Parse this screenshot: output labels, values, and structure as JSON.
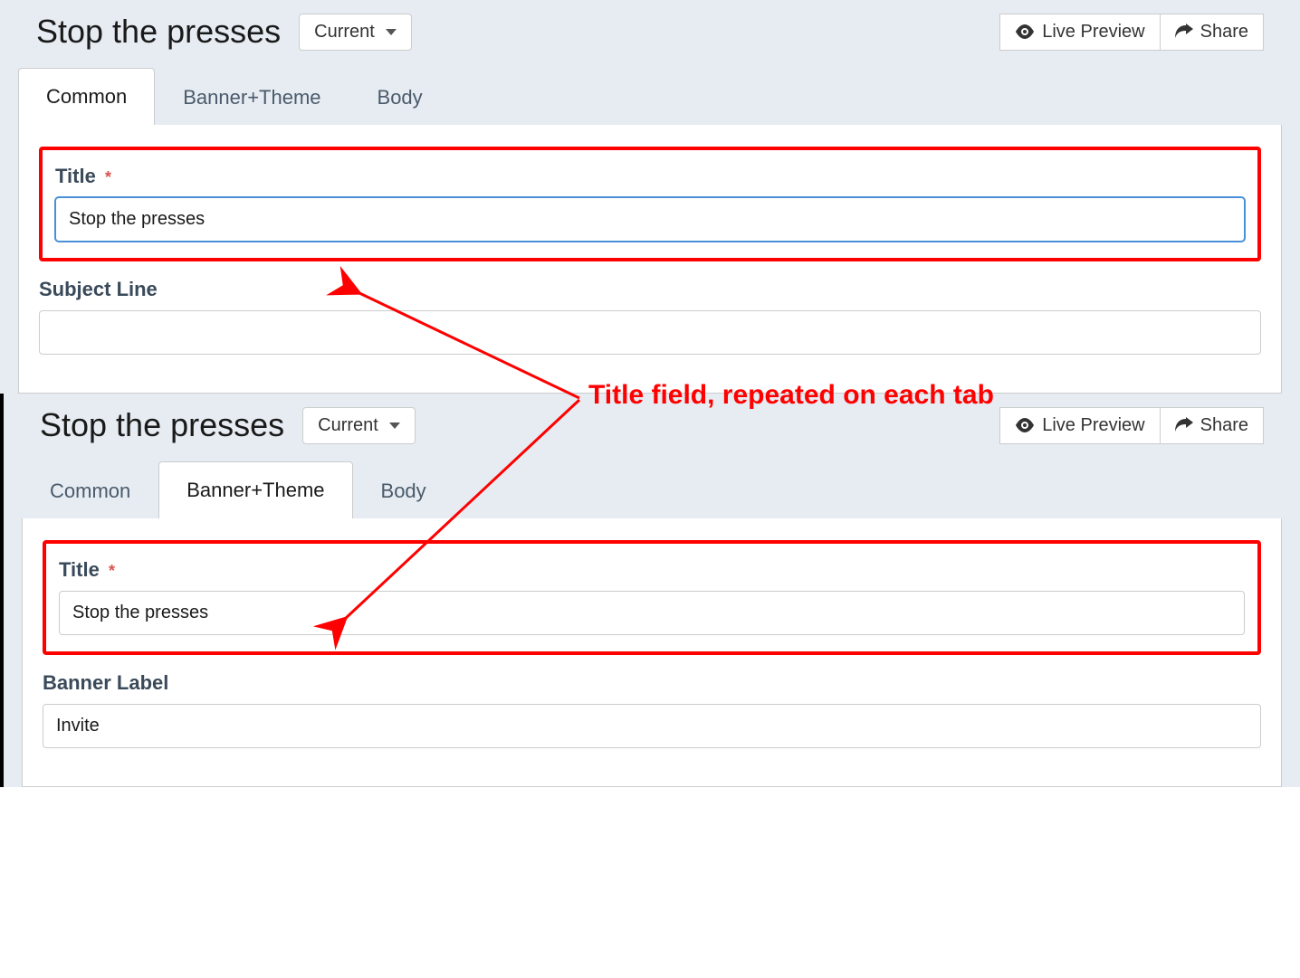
{
  "top": {
    "title": "Stop the presses",
    "dropdown": "Current",
    "actions": {
      "preview": "Live Preview",
      "share": "Share"
    },
    "tabs": [
      "Common",
      "Banner+Theme",
      "Body"
    ],
    "activeTab": 0,
    "form": {
      "titleLabel": "Title",
      "titleValue": "Stop the presses",
      "subjectLabel": "Subject Line",
      "subjectValue": ""
    }
  },
  "bottom": {
    "title": "Stop the presses",
    "dropdown": "Current",
    "actions": {
      "preview": "Live Preview",
      "share": "Share"
    },
    "tabs": [
      "Common",
      "Banner+Theme",
      "Body"
    ],
    "activeTab": 1,
    "form": {
      "titleLabel": "Title",
      "titleValue": "Stop the presses",
      "bannerLabel": "Banner Label",
      "bannerValue": "Invite"
    }
  },
  "annotation": "Title field, repeated on each tab"
}
